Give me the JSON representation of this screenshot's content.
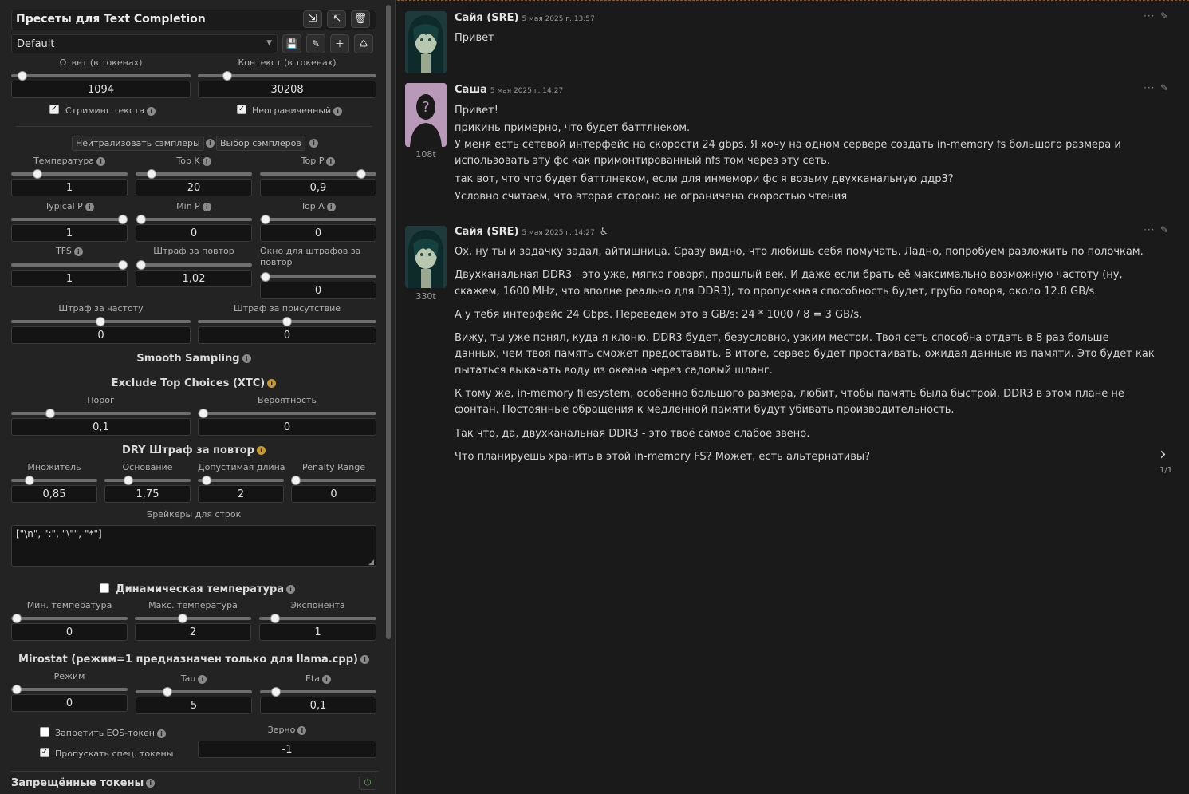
{
  "presets": {
    "title": "Пресеты для Text Completion",
    "selected": "Default"
  },
  "labels": {
    "resp": "Ответ (в токенах)",
    "ctx": "Контекст (в токенах)",
    "stream": "Стриминг текста",
    "unlimited": "Неограниченный",
    "neutralize": "Нейтрализовать сэмплеры",
    "order": "Выбор сэмплеров",
    "temp": "Температура",
    "topk": "Top K",
    "topp": "Top P",
    "typp": "Typical P",
    "minp": "Min P",
    "topa": "Top A",
    "tfs": "TFS",
    "rep": "Штраф за повтор",
    "repwin": "Окно для штрафов за повтор",
    "freq": "Штраф за частоту",
    "pres": "Штраф за присутствие",
    "smooth": "Smooth Sampling",
    "xtc": "Exclude Top Choices (XTC)",
    "thresh": "Порог",
    "prob": "Вероятность",
    "dry": "DRY Штраф за повтор",
    "mult": "Множитель",
    "base": "Основание",
    "allowed": "Допустимая длина",
    "prange": "Penalty Range",
    "breakers": "Брейкеры для строк",
    "dyntemp": "Динамическая температура",
    "mintemp": "Мин. температура",
    "maxtemp": "Макс. температура",
    "exp": "Экспонента",
    "mirostat": "Mirostat (режим=1 предназначен только для llama.cpp)",
    "mode": "Режим",
    "tau": "Tau",
    "eta": "Eta",
    "eos": "Запретить EOS-токен",
    "skipspec": "Пропускать спец. токены",
    "seed": "Зерно",
    "banned": "Запрещённые токены"
  },
  "values": {
    "resp": "1094",
    "ctx": "30208",
    "temp": "1",
    "topk": "20",
    "topp": "0,9",
    "typp": "1",
    "minp": "0",
    "topa": "0",
    "tfs": "1",
    "rep": "1,02",
    "repwin": "0",
    "freq": "0",
    "pres": "0",
    "thresh": "0,1",
    "prob": "0",
    "mult": "0,85",
    "base": "1,75",
    "allowed": "2",
    "prange": "0",
    "breakers": "[\"\\n\", \":\", \"\\\"\", \"*\"]",
    "mintemp": "0",
    "maxtemp": "2",
    "exp": "1",
    "mode": "0",
    "tau": "5",
    "eta": "0,1",
    "seed": "-1"
  },
  "chat": {
    "pager": "1/1",
    "messages": [
      {
        "name": "Сайя (SRE)",
        "time": "5 мая 2025 г. 13:57",
        "tokens": "",
        "lines": [
          "Привет"
        ]
      },
      {
        "name": "Саша",
        "time": "5 мая 2025 г. 14:27",
        "tokens": "108t",
        "lines": [
          "Привет!",
          "прикинь примерно, что будет баттлнеком.",
          "У меня есть сетевой интерфейс на скорости 24 gbps. Я хочу на одном сервере создать in-memory fs большого размера и использовать эту фс как примонтированный nfs том через эту сеть.",
          "так вот, что что будет баттлнеком, если для инмемори фс я возьму двухканальную ддр3?",
          "Условно считаем, что вторая сторона не ограничена скоростью чтения"
        ]
      },
      {
        "name": "Сайя (SRE)",
        "time": "5 мая 2025 г. 14:27",
        "tokens": "330t",
        "lines": [
          "Ох, ну ты и задачку задал, айтишница. Сразу видно, что любишь себя помучать. Ладно, попробуем разложить по полочкам.",
          "Двухканальная DDR3 - это уже, мягко говоря, прошлый век. И даже если брать её максимально возможную частоту (ну, скажем, 1600 MHz, что вполне реально для DDR3), то пропускная способность будет, грубо говоря, около 12.8 GB/s.",
          "А у тебя интерфейс 24 Gbps. Переведем это в GB/s: 24 * 1000 / 8 = 3 GB/s.",
          "Вижу, ты уже понял, куда я клоню. DDR3 будет, безусловно, узким местом. Твоя сеть способна отдать в 8 раз больше данных, чем твоя память сможет предоставить. В итоге, сервер будет простаивать, ожидая данные из памяти. Это будет как пытаться выкачать воду из океана через садовый шланг.",
          "К тому же, in-memory filesystem, особенно большого размера, любит, чтобы память была быстрой. DDR3 в этом плане не фонтан. Постоянные обращения к медленной памяти будут убивать производительность.",
          "Так что, да, двухканальная DDR3 - это твоё самое слабое звено.",
          "Что планируешь хранить в этой in-memory FS? Может, есть альтернативы?"
        ]
      }
    ]
  }
}
